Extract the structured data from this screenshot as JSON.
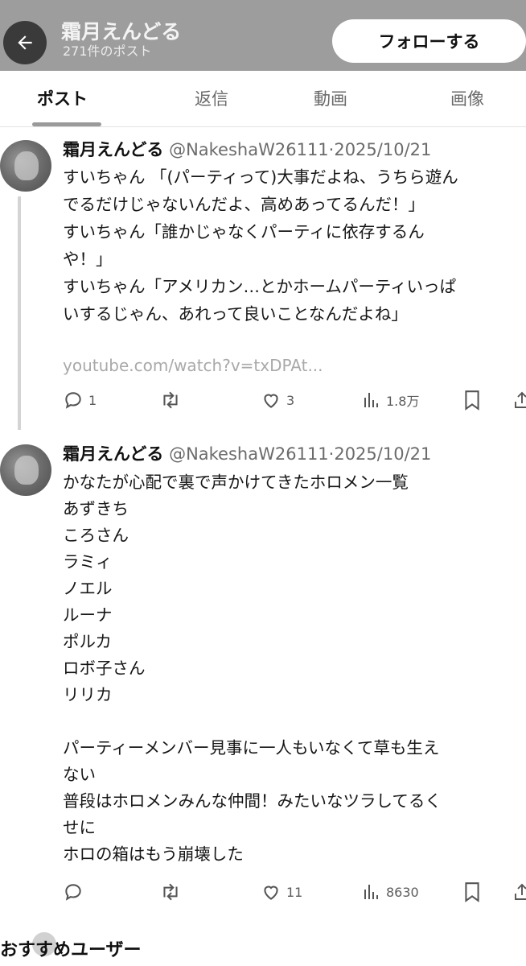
{
  "header": {
    "profile_name": "霜月えんどる",
    "post_count": "271件のポスト",
    "follow_label": "フォローする"
  },
  "tabs": [
    {
      "label": "ポスト",
      "active": true
    },
    {
      "label": "返信",
      "active": false
    },
    {
      "label": "動画",
      "active": false
    },
    {
      "label": "画像",
      "active": false
    }
  ],
  "posts": [
    {
      "name": "霜月えんどる",
      "handle_date": "@NakeshaW26111·2025/10/21",
      "lines": [
        "すいちゃん 「(パーティって)大事だよね、うちら遊ん",
        "でるだけじゃないんだよ、高めあってるんだ！」",
        "すいちゃん「誰かじゃなくパーティに依存するん",
        "や！」",
        "すいちゃん「アメリカン…とかホームパーティいっぱ",
        "いするじゃん、あれって良いことなんだよね」"
      ],
      "link": "youtube.com/watch?v=txDPAt...",
      "replies": "1",
      "reposts": "",
      "likes": "3",
      "views": "1.8万"
    },
    {
      "name": "霜月えんどる",
      "handle_date": "@NakeshaW26111·2025/10/21",
      "lines": [
        "かなたが心配で裏で声かけてきたホロメン一覧",
        "あずきち",
        "ころさん",
        "ラミィ",
        "ノエル",
        "ルーナ",
        "ポルカ",
        "ロボ子さん",
        "リリカ",
        "",
        "パーティーメンバー見事に一人もいなくて草も生え",
        "ない",
        "普段はホロメンみんな仲間！みたいなツラしてるく",
        "せに",
        "ホロの箱はもう崩壊した"
      ],
      "replies": "",
      "reposts": "",
      "likes": "11",
      "views": "8630"
    }
  ],
  "recommend_title": "おすすめユーザー"
}
